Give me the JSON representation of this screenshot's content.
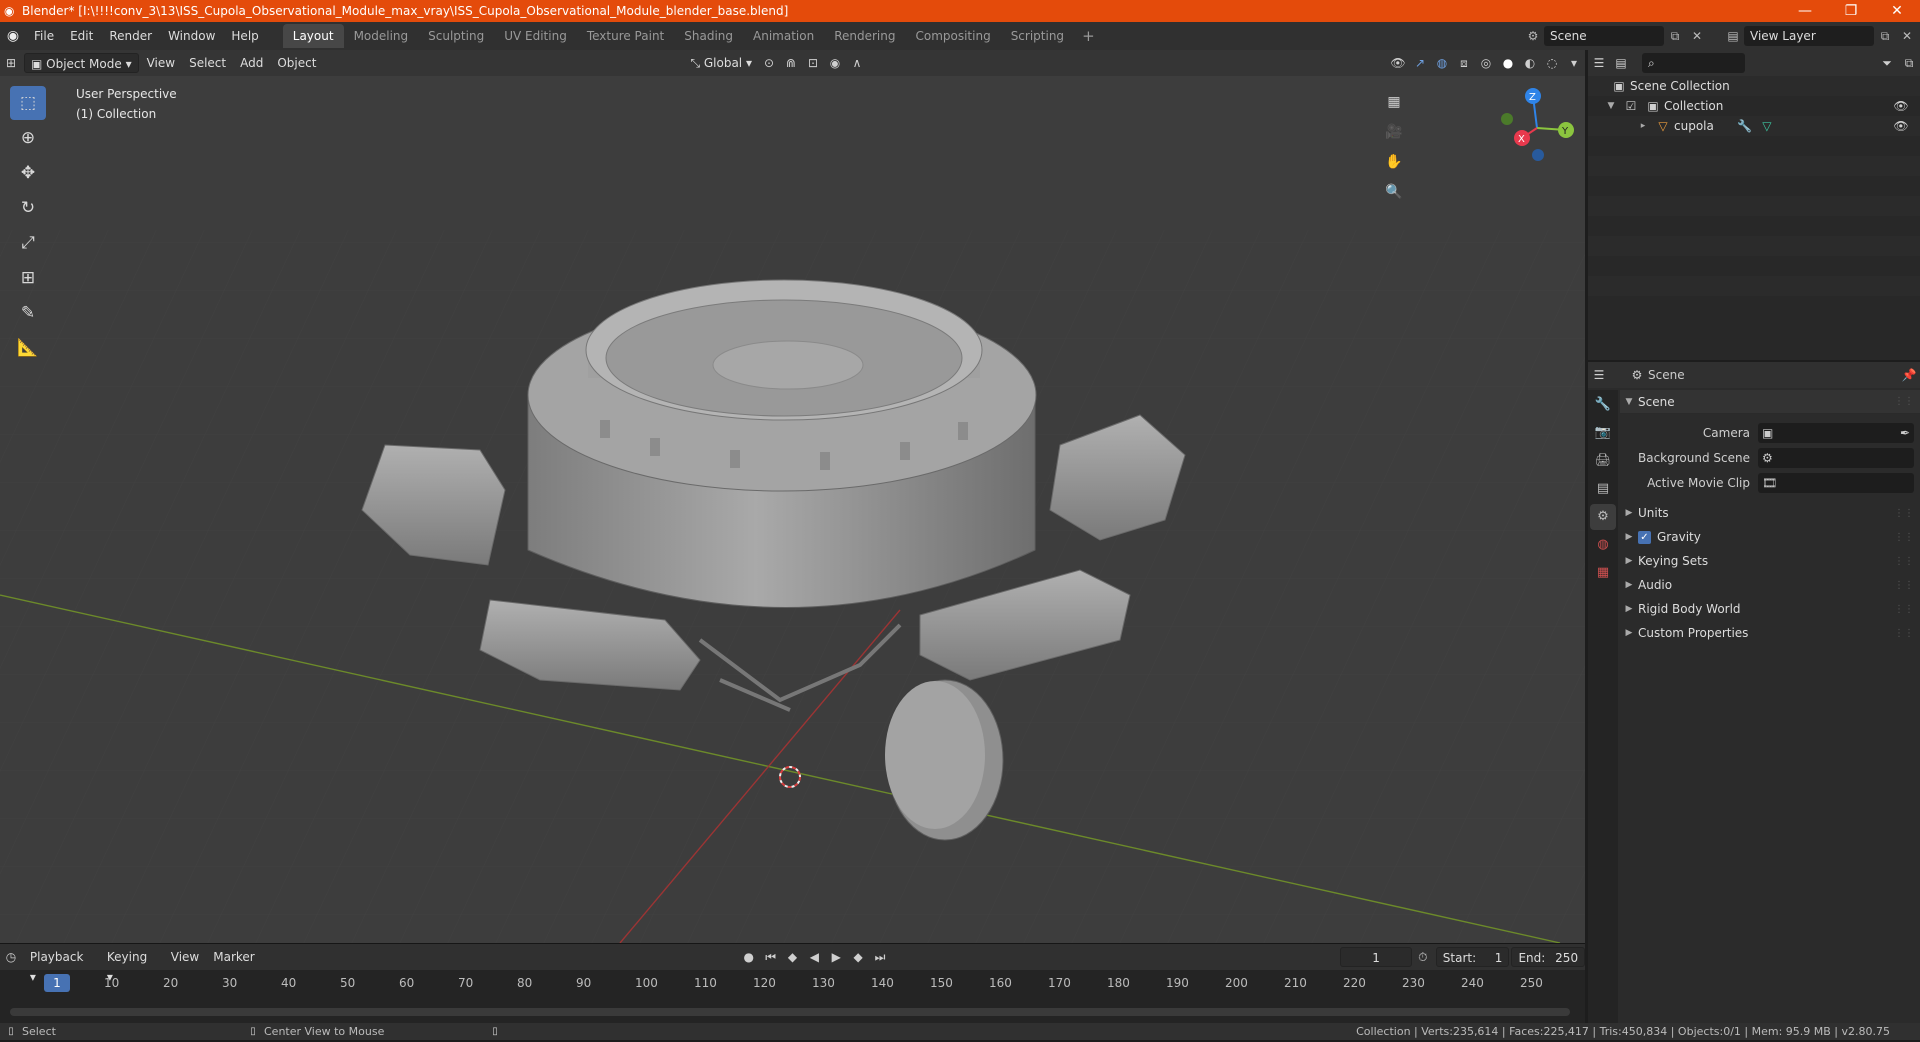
{
  "window": {
    "title": "Blender* [I:\\!!!!conv_3\\13\\ISS_Cupola_Observational_Module_max_vray\\ISS_Cupola_Observational_Module_blender_base.blend]",
    "minimize_icon": "minimize-icon",
    "maximize_icon": "maximize-icon",
    "close_icon": "close-icon"
  },
  "menubar": {
    "menus": [
      "File",
      "Edit",
      "Render",
      "Window",
      "Help"
    ],
    "workspaces": [
      "Layout",
      "Modeling",
      "Sculpting",
      "UV Editing",
      "Texture Paint",
      "Shading",
      "Animation",
      "Rendering",
      "Compositing",
      "Scripting"
    ],
    "active_workspace": "Layout",
    "add_workspace": "+",
    "scene": "Scene",
    "view_layer": "View Layer"
  },
  "viewport": {
    "mode": "Object Mode",
    "menus": [
      "View",
      "Select",
      "Add",
      "Object"
    ],
    "transform_orientation": "Global",
    "info_line1": "User Perspective",
    "info_line2": "(1) Collection",
    "gizmo_axes": [
      "X",
      "Y",
      "Z"
    ]
  },
  "timeline": {
    "menus": [
      "Playback",
      "Keying",
      "View",
      "Marker"
    ],
    "current_frame": "1",
    "start_label": "Start:",
    "start": "1",
    "end_label": "End:",
    "end": "250",
    "ticks": [
      "10",
      "20",
      "30",
      "40",
      "50",
      "60",
      "70",
      "80",
      "90",
      "100",
      "110",
      "120",
      "130",
      "140",
      "150",
      "160",
      "170",
      "180",
      "190",
      "200",
      "210",
      "220",
      "230",
      "240",
      "250"
    ],
    "playhead": "1"
  },
  "statusbar": {
    "left_action": "Select",
    "mid_action": "Center View to Mouse",
    "stats": "Collection | Verts:235,614 | Faces:225,417 | Tris:450,834 | Objects:0/1 | Mem: 95.9 MB | v2.80.75"
  },
  "outliner": {
    "root": "Scene Collection",
    "collection": "Collection",
    "object": "cupola"
  },
  "properties": {
    "header_title": "Scene",
    "section_title": "Scene",
    "camera_label": "Camera",
    "background_scene_label": "Background Scene",
    "active_movie_clip_label": "Active Movie Clip",
    "subpanels": [
      "Units",
      "Gravity",
      "Keying Sets",
      "Audio",
      "Rigid Body World",
      "Custom Properties"
    ],
    "gravity_checked": true
  },
  "colors": {
    "accent": "#4772b3",
    "titlebar": "#e44b0b",
    "x_axis": "#e8394d",
    "y_axis": "#8bc53f",
    "z_axis": "#2f84e8"
  }
}
